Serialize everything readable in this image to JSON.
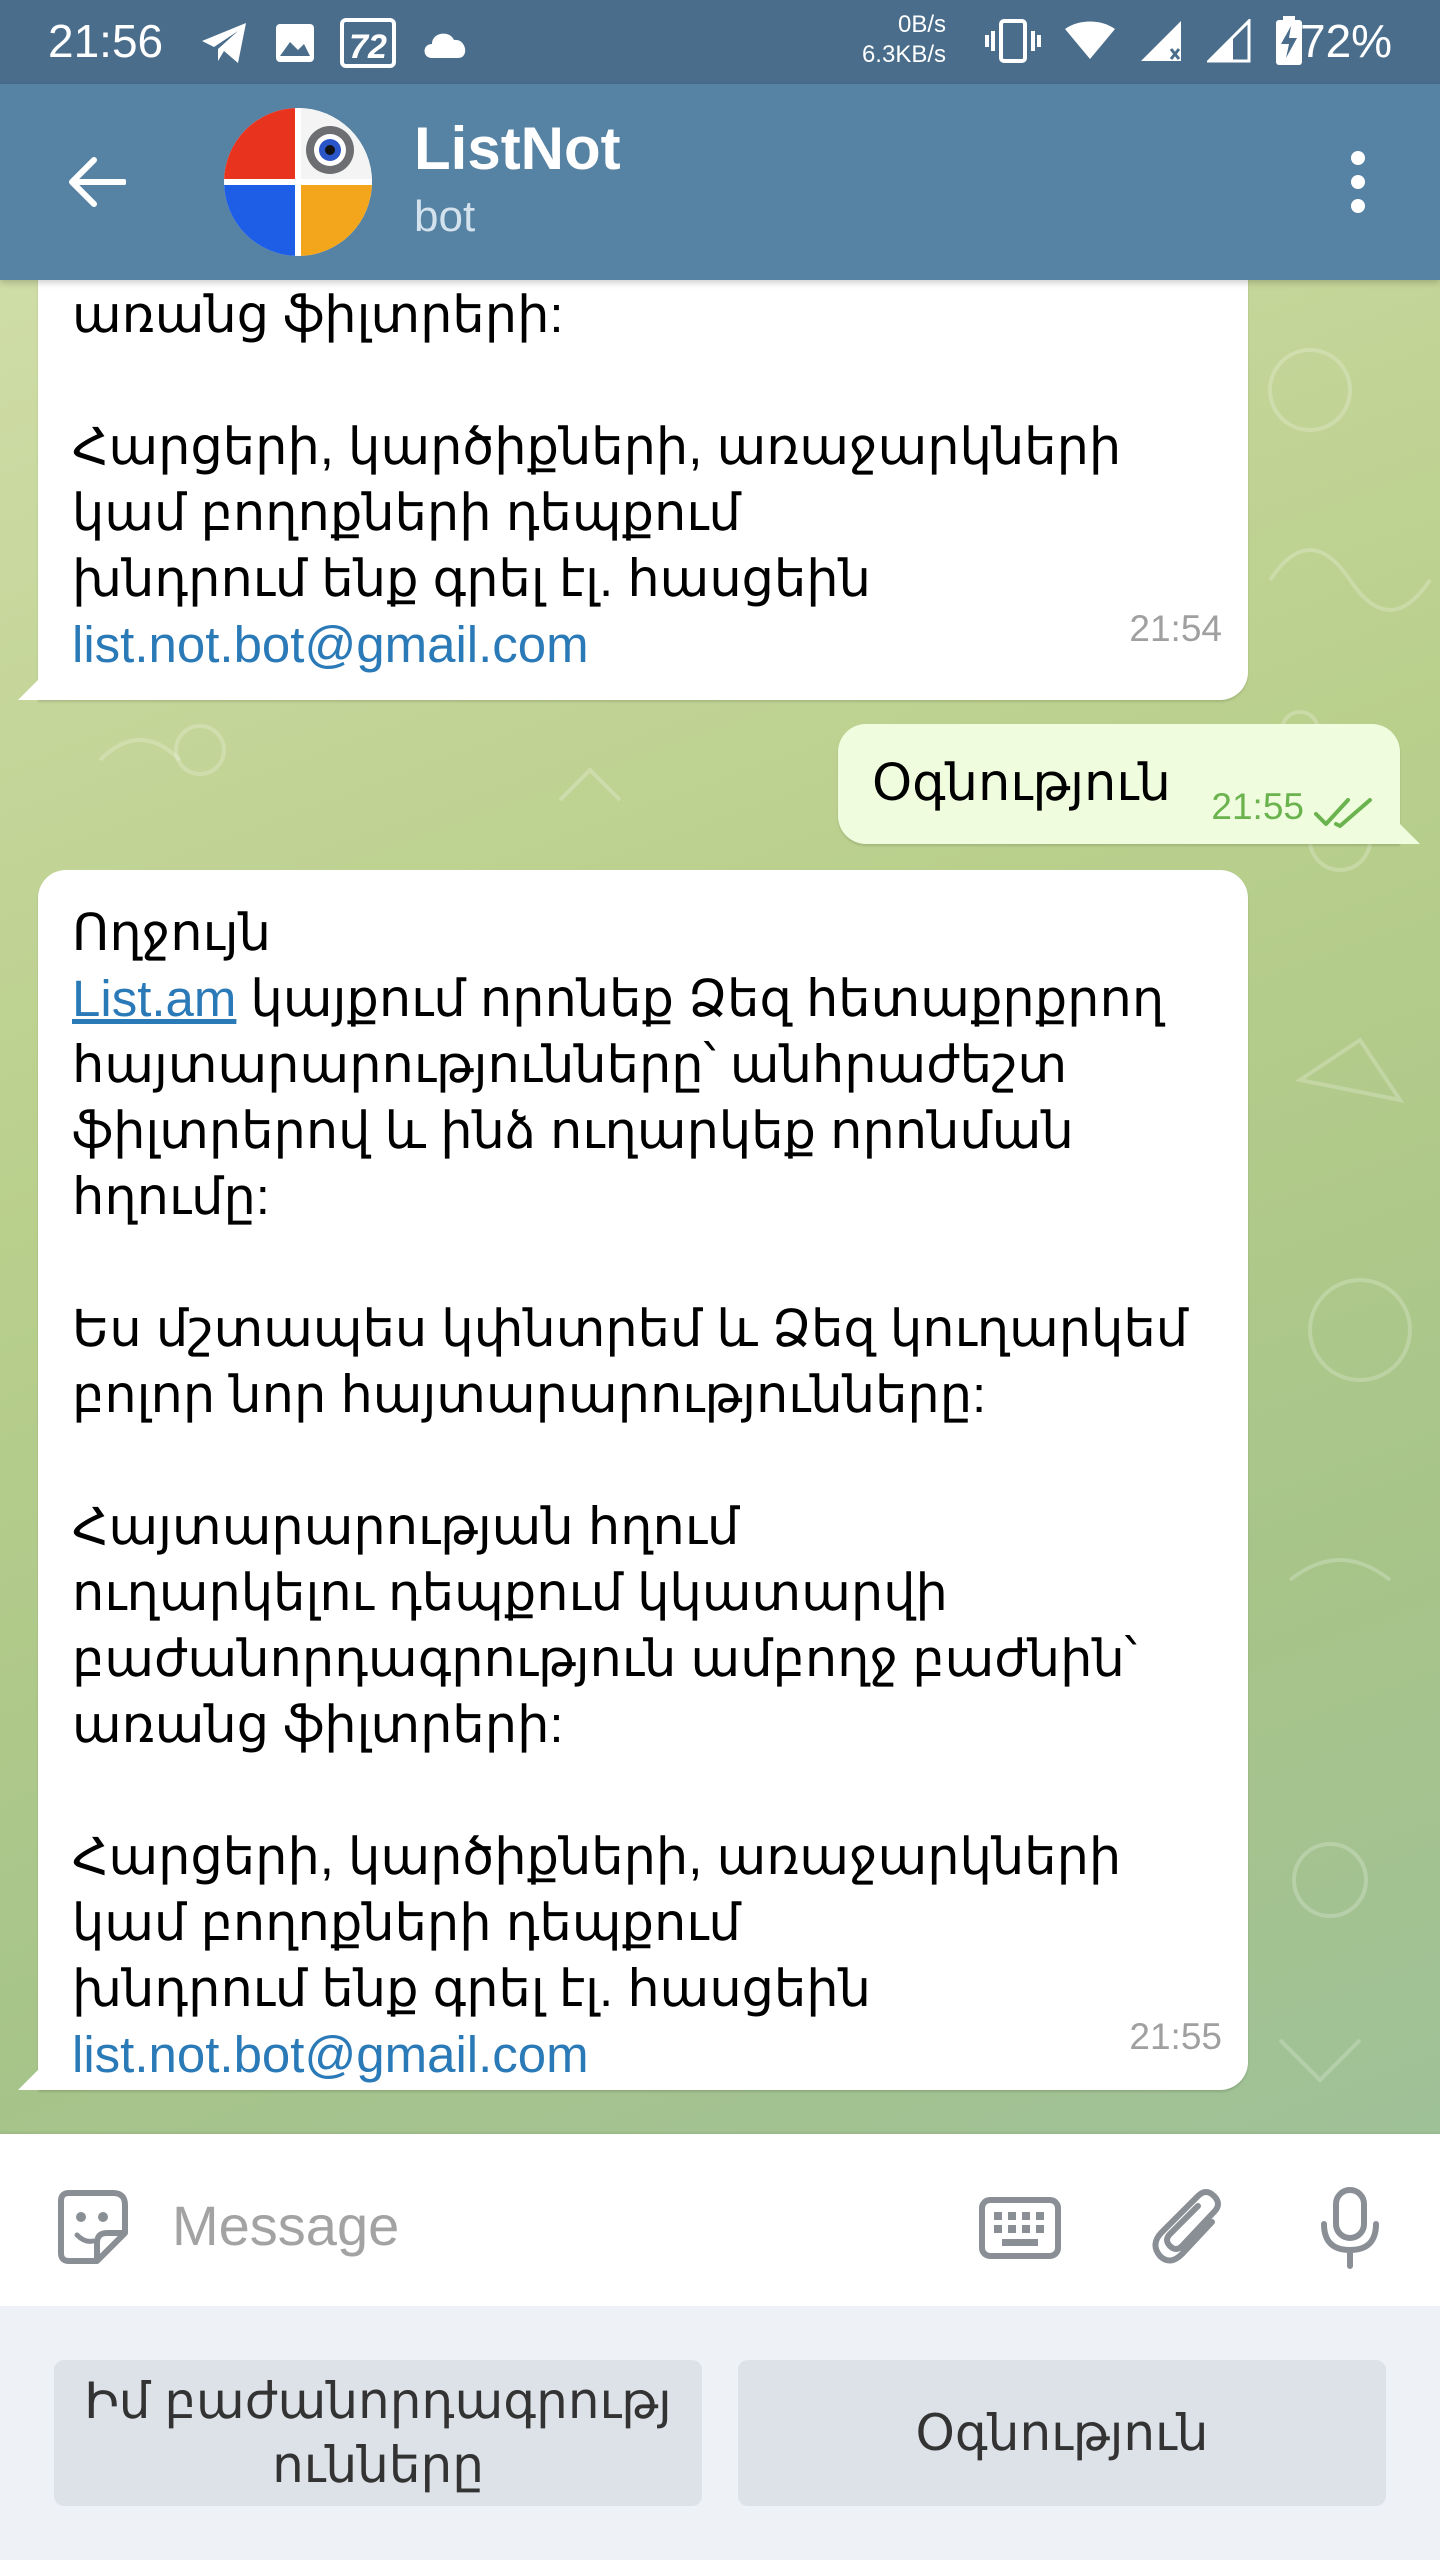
{
  "status_bar": {
    "time": "21:56",
    "notification_badge": "72",
    "net_speed_up": "0B/s",
    "net_speed_down": "6.3KB/s",
    "battery_percent": "72%",
    "icons": [
      "telegram-icon",
      "image-icon",
      "badge-72-icon",
      "cloud-icon",
      "vibrate-icon",
      "wifi-icon",
      "signal-icon",
      "signal-icon",
      "battery-charging-icon"
    ]
  },
  "header": {
    "title": "ListNot",
    "subtitle": "bot"
  },
  "messages": [
    {
      "lines": [
        "առանց ֆիլտրերի:",
        "",
        "Հարցերի, կարծիքների, առաջարկների",
        "կամ բողոքների դեպքում",
        "խնդրում ենք գրել էլ. հասցեին"
      ],
      "email": "list.not.bot@gmail.com",
      "time": "21:54"
    },
    {
      "text": "Օգնություն",
      "time": "21:55",
      "status": "read"
    },
    {
      "line1": "Ողջույն",
      "link_text": "List.am",
      "line2_rest": " կայքում որոնեք Ձեզ հետաքրքրող",
      "lines_a": [
        "հայտարարությունները՝ անհրաժեշտ",
        "ֆիլտրերով և ինձ ուղարկեք որոնման",
        "հղումը:"
      ],
      "lines_b": [
        "Ես մշտապես կփնտրեմ և Ձեզ կուղարկեմ",
        "բոլոր նոր հայտարարությունները:"
      ],
      "lines_c": [
        "Հայտարարության հղում",
        "ուղարկելու դեպքում կկատարվի",
        "բաժանորդագրություն ամբողջ բաժնին՝",
        "առանց ֆիլտրերի:"
      ],
      "lines_d": [
        "Հարցերի, կարծիքների, առաջարկների",
        "կամ բողոքների դեպքում",
        "խնդրում ենք գրել էլ. հասցեին"
      ],
      "email": "list.not.bot@gmail.com",
      "time": "21:55"
    }
  ],
  "composer": {
    "placeholder": "Message"
  },
  "bot_keyboard": {
    "button1": "Իմ բաժանորդագրությ ունները",
    "button2": "Օգնություն"
  },
  "colors": {
    "status_bar": "#4a6d8c",
    "app_bar": "#5682a3",
    "incoming_bubble": "#ffffff",
    "outgoing_bubble": "#effdde",
    "link": "#2b7ab8",
    "read_ticks": "#6bb34e"
  }
}
